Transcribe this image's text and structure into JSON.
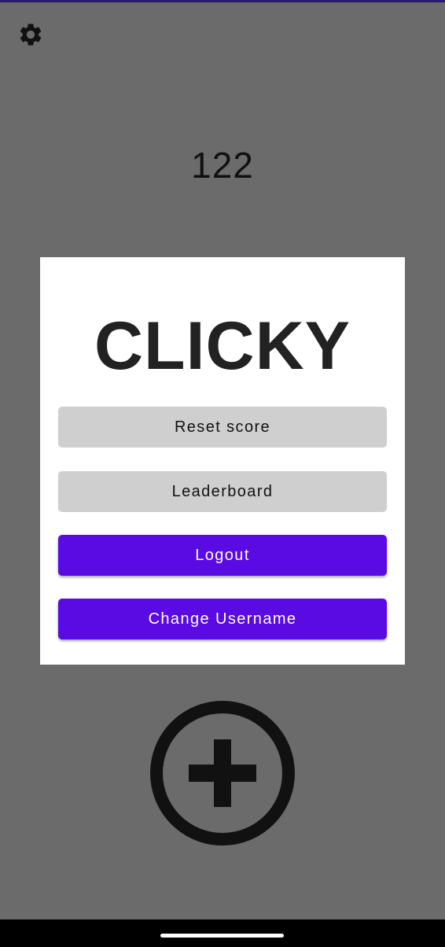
{
  "app": {
    "score": "122",
    "settings_icon": "gear-icon",
    "click_icon": "add-circle-icon"
  },
  "dialog": {
    "title": "CLICKY",
    "buttons": {
      "reset": "Reset score",
      "leaderboard": "Leaderboard",
      "logout": "Logout",
      "change_username": "Change Username"
    }
  },
  "colors": {
    "accent": "#5a0ae3",
    "secondary_button": "#cfcfcf",
    "scrim_background": "#6b6b6b",
    "dialog_background": "#ffffff"
  }
}
